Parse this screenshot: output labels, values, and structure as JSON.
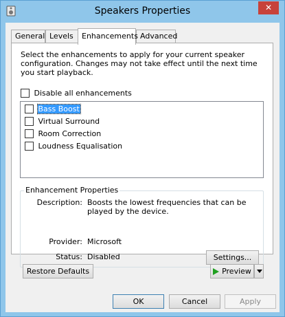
{
  "window": {
    "title": "Speakers Properties",
    "close_label": "✕",
    "app_icon": "speaker-icon"
  },
  "tabs": [
    {
      "label": "General"
    },
    {
      "label": "Levels"
    },
    {
      "label": "Enhancements",
      "active": true
    },
    {
      "label": "Advanced"
    }
  ],
  "enhancements": {
    "intro": "Select the enhancements to apply for your current speaker configuration. Changes may not take effect until the next time you start playback.",
    "disable_all": "Disable all enhancements",
    "items": [
      {
        "label": "Bass Boost",
        "checked": false,
        "selected": true
      },
      {
        "label": "Virtual Surround",
        "checked": false
      },
      {
        "label": "Room Correction",
        "checked": false
      },
      {
        "label": "Loudness Equalisation",
        "checked": false
      }
    ]
  },
  "properties": {
    "group_title": "Enhancement Properties",
    "description_label": "Description:",
    "description": "Boosts the lowest frequencies that can be played by the device.",
    "provider_label": "Provider:",
    "provider": "Microsoft",
    "status_label": "Status:",
    "status": "Disabled",
    "settings_button": "Settings..."
  },
  "actions": {
    "restore_defaults": "Restore Defaults",
    "preview": "Preview"
  },
  "dialog_buttons": {
    "ok": "OK",
    "cancel": "Cancel",
    "apply": "Apply"
  },
  "colors": {
    "frame": "#8fc6ea",
    "close": "#c7423a",
    "selection": "#3399ff",
    "preview_play": "#20a020"
  }
}
